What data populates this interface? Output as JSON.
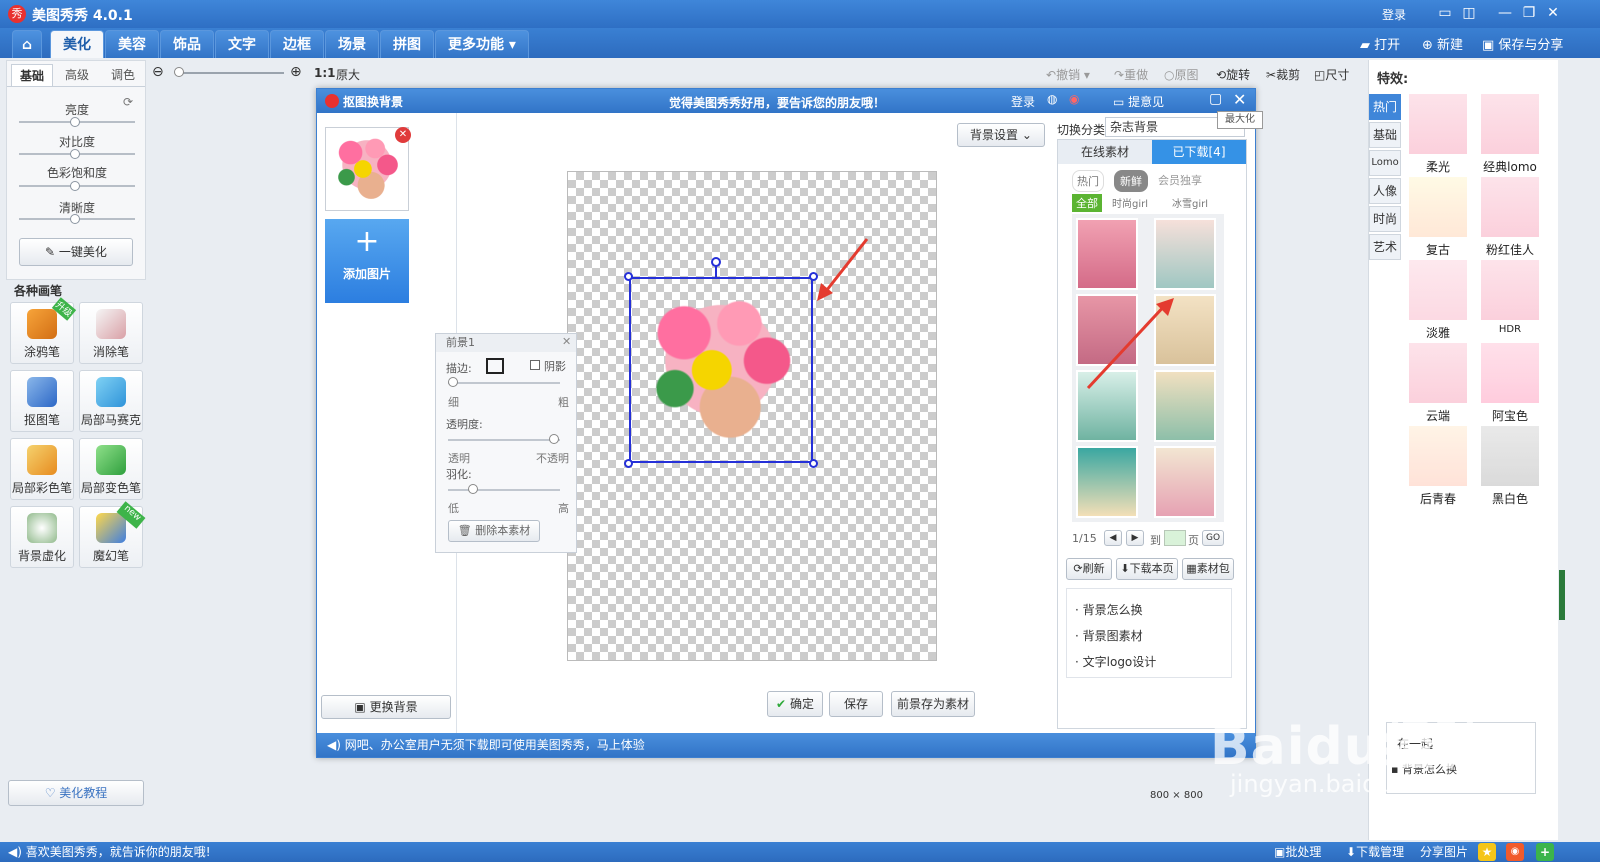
{
  "app": {
    "title": "美图秀秀 4.0.1",
    "logo_char": "秀",
    "login": "登录"
  },
  "menu": {
    "tabs": [
      "美化",
      "美容",
      "饰品",
      "文字",
      "边框",
      "场景",
      "拼图",
      "更多功能"
    ],
    "open": "打开",
    "new": "新建",
    "save_share": "保存与分享"
  },
  "toolbar": {
    "zoom_ratio": "1:1",
    "original_size": "原大",
    "undo": "撤销",
    "redo": "重做",
    "original": "原图",
    "rotate": "旋转",
    "crop": "裁剪",
    "size": "尺寸"
  },
  "left": {
    "tabs": [
      "基础",
      "高级",
      "调色"
    ],
    "sliders": [
      {
        "label": "亮度",
        "value": 0.5
      },
      {
        "label": "对比度",
        "value": 0.5
      },
      {
        "label": "色彩饱和度",
        "value": 0.5
      },
      {
        "label": "清晰度",
        "value": 0.5
      }
    ],
    "one_click": "一键美化",
    "brushes_title": "各种画笔",
    "brushes": [
      {
        "label": "涂鸦笔",
        "badge": "升级"
      },
      {
        "label": "消除笔",
        "badge": ""
      },
      {
        "label": "抠图笔",
        "badge": ""
      },
      {
        "label": "局部马赛克",
        "badge": ""
      },
      {
        "label": "局部彩色笔",
        "badge": ""
      },
      {
        "label": "局部变色笔",
        "badge": ""
      },
      {
        "label": "背景虚化",
        "badge": ""
      },
      {
        "label": "魔幻笔",
        "badge": "new"
      }
    ],
    "tutorial": "美化教程"
  },
  "dialog": {
    "title": "抠图换背景",
    "slogan": "觉得美图秀秀好用，要告诉您的朋友哦！",
    "login": "登录",
    "feedback": "提意见",
    "maximize_tip": "最大化",
    "add_image": "添加图片",
    "change_bg": "更换背景",
    "bg_settings": "背景设置",
    "switch_category": "切换分类",
    "category_value": "杂志背景",
    "online_tab": "在线素材",
    "downloaded_tab": "已下载[4]",
    "filter_tabs": [
      "热门",
      "新鲜",
      "会员独享"
    ],
    "sub_filters": [
      "全部",
      "时尚girl",
      "冰雪girl"
    ],
    "pager": {
      "current": "1/15",
      "to": "到",
      "page": "页",
      "go": "GO"
    },
    "actions": {
      "refresh": "刷新",
      "download_page": "下载本页",
      "material_pack": "素材包"
    },
    "help_links": [
      "背景怎么换",
      "背景图素材",
      "文字logo设计"
    ],
    "footer": "网吧、办公室用户无须下载即可使用美图秀秀，马上体验",
    "ok": "确定",
    "save": "保存",
    "save_fg": "前景存为素材",
    "fg_panel": {
      "title": "前景1",
      "stroke": "描边:",
      "shadow": "阴影",
      "thin": "细",
      "thick": "粗",
      "opacity": "透明度:",
      "transparent": "透明",
      "opaque": "不透明",
      "feather": "羽化:",
      "low": "低",
      "high": "高",
      "delete": "删除本素材"
    }
  },
  "right": {
    "title": "特效:",
    "tabs": [
      "热门",
      "基础",
      "Lomo",
      "人像",
      "时尚",
      "艺术"
    ],
    "effects": [
      "柔光",
      "经典lomo",
      "复古",
      "粉红佳人",
      "淡雅",
      "HDR",
      "云端",
      "阿宝色",
      "后青春",
      "黑白色"
    ]
  },
  "canvas_info": {
    "w": "800",
    "x": "×",
    "h": "800"
  },
  "ad": {
    "title": "在一起",
    "link": "背景怎么换"
  },
  "status": {
    "left": "喜欢美图秀秀，就告诉你的朋友哦!",
    "batch": "批处理",
    "download_mgr": "下载管理",
    "share": "分享图片"
  },
  "watermark": {
    "brand": "Baidu经验",
    "url": "jingyan.baidu.com"
  }
}
